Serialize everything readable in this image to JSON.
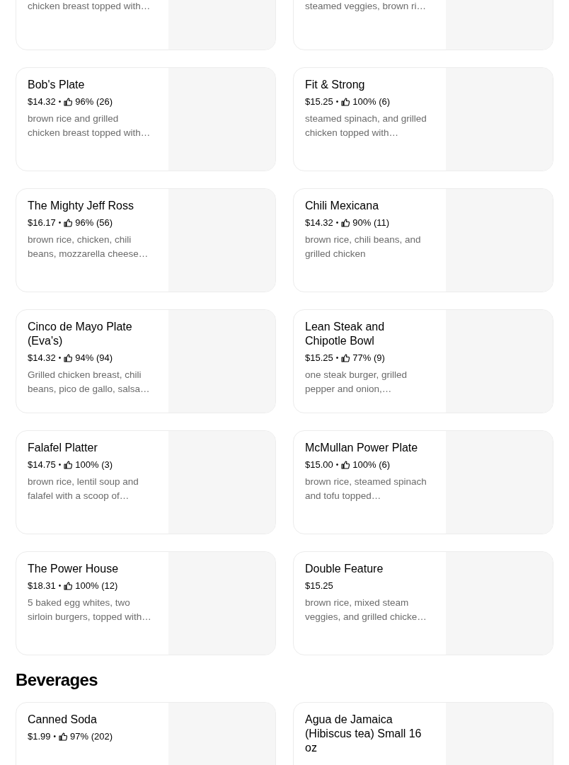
{
  "sections": [
    {
      "items": [
        {
          "description": "chicken breast topped with…"
        },
        {
          "description": "steamed veggies, brown ri…"
        },
        {
          "name": "Bob's Plate",
          "price": "$14.32",
          "separator": "•",
          "rating": "96% (26)",
          "description": "brown rice and grilled chicken breast topped with…"
        },
        {
          "name": "Fit & Strong",
          "price": "$15.25",
          "separator": "•",
          "rating": "100% (6)",
          "description": "steamed spinach, and grilled chicken topped with…"
        },
        {
          "name": "The Mighty Jeff Ross",
          "price": "$16.17",
          "separator": "•",
          "rating": "96% (56)",
          "description": "brown rice, chicken, chili beans, mozzarella cheese…"
        },
        {
          "name": "Chili Mexicana",
          "price": "$14.32",
          "separator": "•",
          "rating": "90% (11)",
          "description": "brown rice, chili beans, and grilled chicken"
        },
        {
          "name": "Cinco de Mayo Plate (Eva's)",
          "price": "$14.32",
          "separator": "•",
          "rating": "94% (94)",
          "description": "Grilled chicken breast, chili beans, pico de gallo, salsa…"
        },
        {
          "name": "Lean Steak and Chipotle Bowl",
          "price": "$15.25",
          "separator": "•",
          "rating": "77% (9)",
          "description": "one steak burger, grilled pepper and onion,…"
        },
        {
          "name": "Falafel Platter",
          "price": "$14.75",
          "separator": "•",
          "rating": "100% (3)",
          "description": "brown rice, lentil soup and falafel with a scoop of…"
        },
        {
          "name": "McMullan Power Plate",
          "price": "$15.00",
          "separator": "•",
          "rating": "100% (6)",
          "description": "brown rice, steamed spinach and tofu topped…"
        },
        {
          "name": "The Power House",
          "price": "$18.31",
          "separator": "•",
          "rating": "100% (12)",
          "description": "5 baked egg whites, two sirloin burgers, topped with…"
        },
        {
          "name": "Double Feature",
          "price": "$15.25",
          "description": "brown rice, mixed steam veggies, and grilled chicke…"
        }
      ]
    },
    {
      "title": "Beverages",
      "items": [
        {
          "name": "Canned Soda",
          "price": "$1.99",
          "separator": "•",
          "rating": "97% (202)"
        },
        {
          "name": "Agua de Jamaica (Hibiscus tea) Small 16 oz"
        }
      ]
    }
  ]
}
